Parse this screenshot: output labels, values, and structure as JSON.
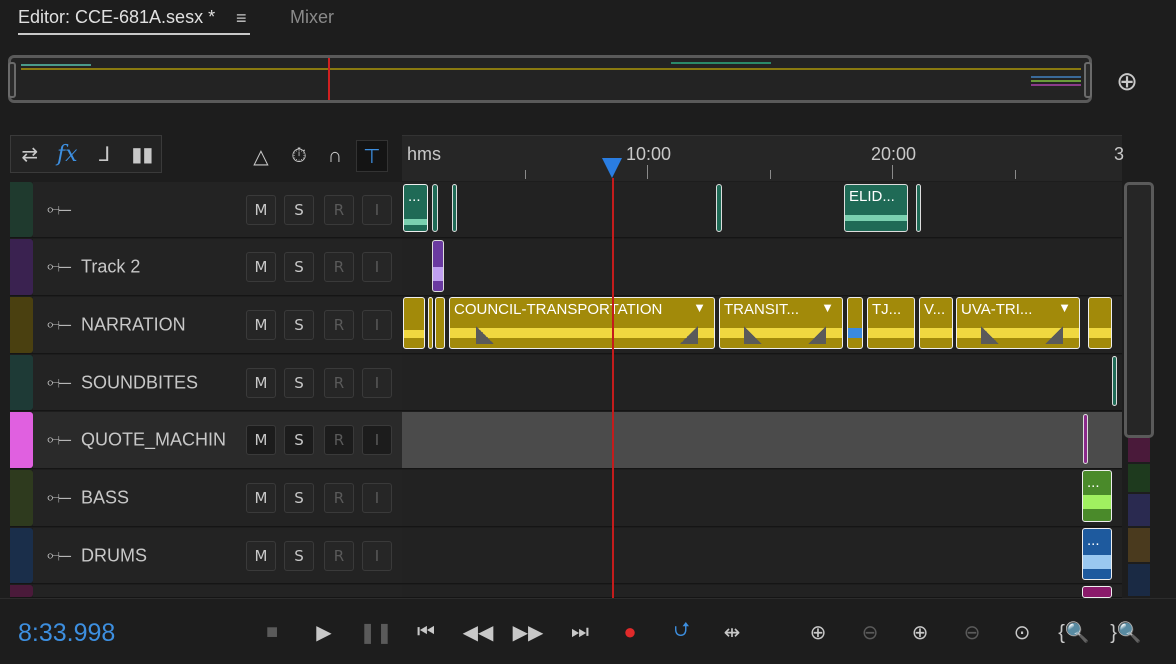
{
  "tabs": {
    "editor": "Editor: CCE-681A.sesx *",
    "menu": "≡",
    "mixer": "Mixer"
  },
  "ruler": {
    "unit": "hms",
    "labels": [
      "10:00",
      "20:00",
      "3"
    ]
  },
  "track_buttons": {
    "mute": "M",
    "solo": "S",
    "record": "R",
    "input": "I"
  },
  "tracks": [
    {
      "name": "",
      "color": "#1f3a2e"
    },
    {
      "name": "Track 2",
      "color": "#3a2250"
    },
    {
      "name": "NARRATION",
      "color": "#4a4010"
    },
    {
      "name": "SOUNDBITES",
      "color": "#1e3a36"
    },
    {
      "name": "QUOTE_MACHIN",
      "color": "#e060e0"
    },
    {
      "name": "BASS",
      "color": "#2e3a1e"
    },
    {
      "name": "DRUMS",
      "color": "#1a2e4a"
    }
  ],
  "clips": {
    "track1_a": "...",
    "track1_b": "ELID...",
    "narr_a": "COUNCIL-TRANSPORTATION",
    "narr_b": "TRANSIT...",
    "narr_c": "TJ...",
    "narr_d": "V...",
    "narr_e": "UVA-TRI...",
    "bass": "...",
    "drums": "..."
  },
  "transport": {
    "timecode": "8:33.998"
  },
  "icons": {
    "zoom_full": "zoom-full-icon",
    "switch": "switch-icon",
    "fx": "fx",
    "send": "send-icon",
    "eq": "eq-icon",
    "metronome": "metronome-icon",
    "stretch": "stretch-icon",
    "snap": "snap-icon",
    "playhead_pin": "pin-icon"
  },
  "colors": {
    "accent": "#3d8fe0",
    "playhead": "#c41c1c",
    "narration_clip": "#a28a0a",
    "track1_clip": "#1f6a56",
    "bass_clip": "#4a8a2a",
    "drums_clip": "#1e5a9e"
  }
}
